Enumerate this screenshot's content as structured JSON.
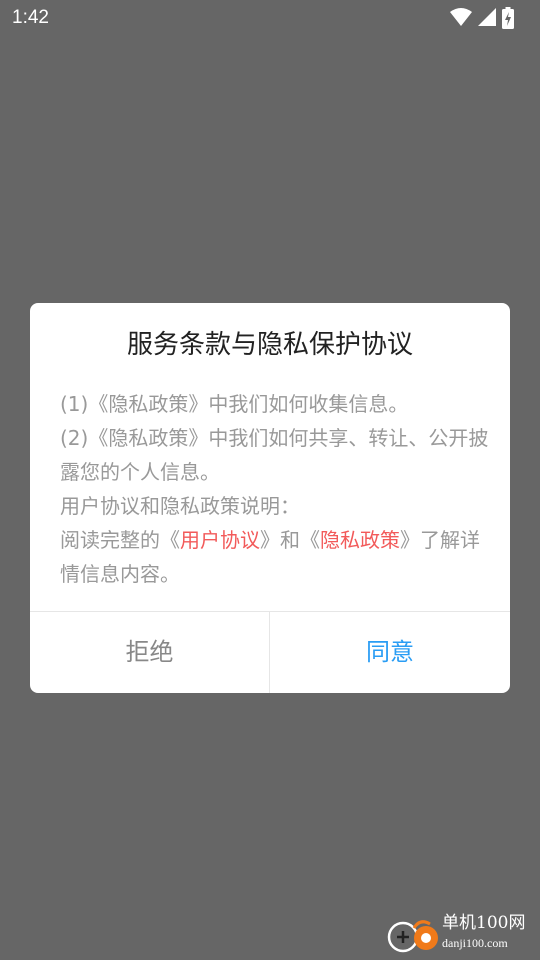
{
  "status_bar": {
    "time": "1:42",
    "icons": [
      "wifi-icon",
      "cellular-signal-icon",
      "battery-charging-icon"
    ]
  },
  "dialog": {
    "title": "服务条款与隐私保护协议",
    "lines": {
      "line1": "(1)《隐私政策》中我们如何收集信息。",
      "line2": "(2)《隐私政策》中我们如何共享、转让、公开披露您的个人信息。",
      "line3": "用户协议和隐私政策说明：",
      "line4_prefix": "阅读完整的《",
      "line4_link1": "用户协议",
      "line4_middle": "》和《",
      "line4_link2": "隐私政策",
      "line4_suffix": "》了解详情信息内容。"
    },
    "buttons": {
      "reject": "拒绝",
      "agree": "同意"
    }
  },
  "watermark": {
    "name": "单机100网",
    "url": "danji100.com"
  },
  "colors": {
    "overlay": "#666666",
    "link": "#f25a5a",
    "agree": "#2a9df4"
  }
}
